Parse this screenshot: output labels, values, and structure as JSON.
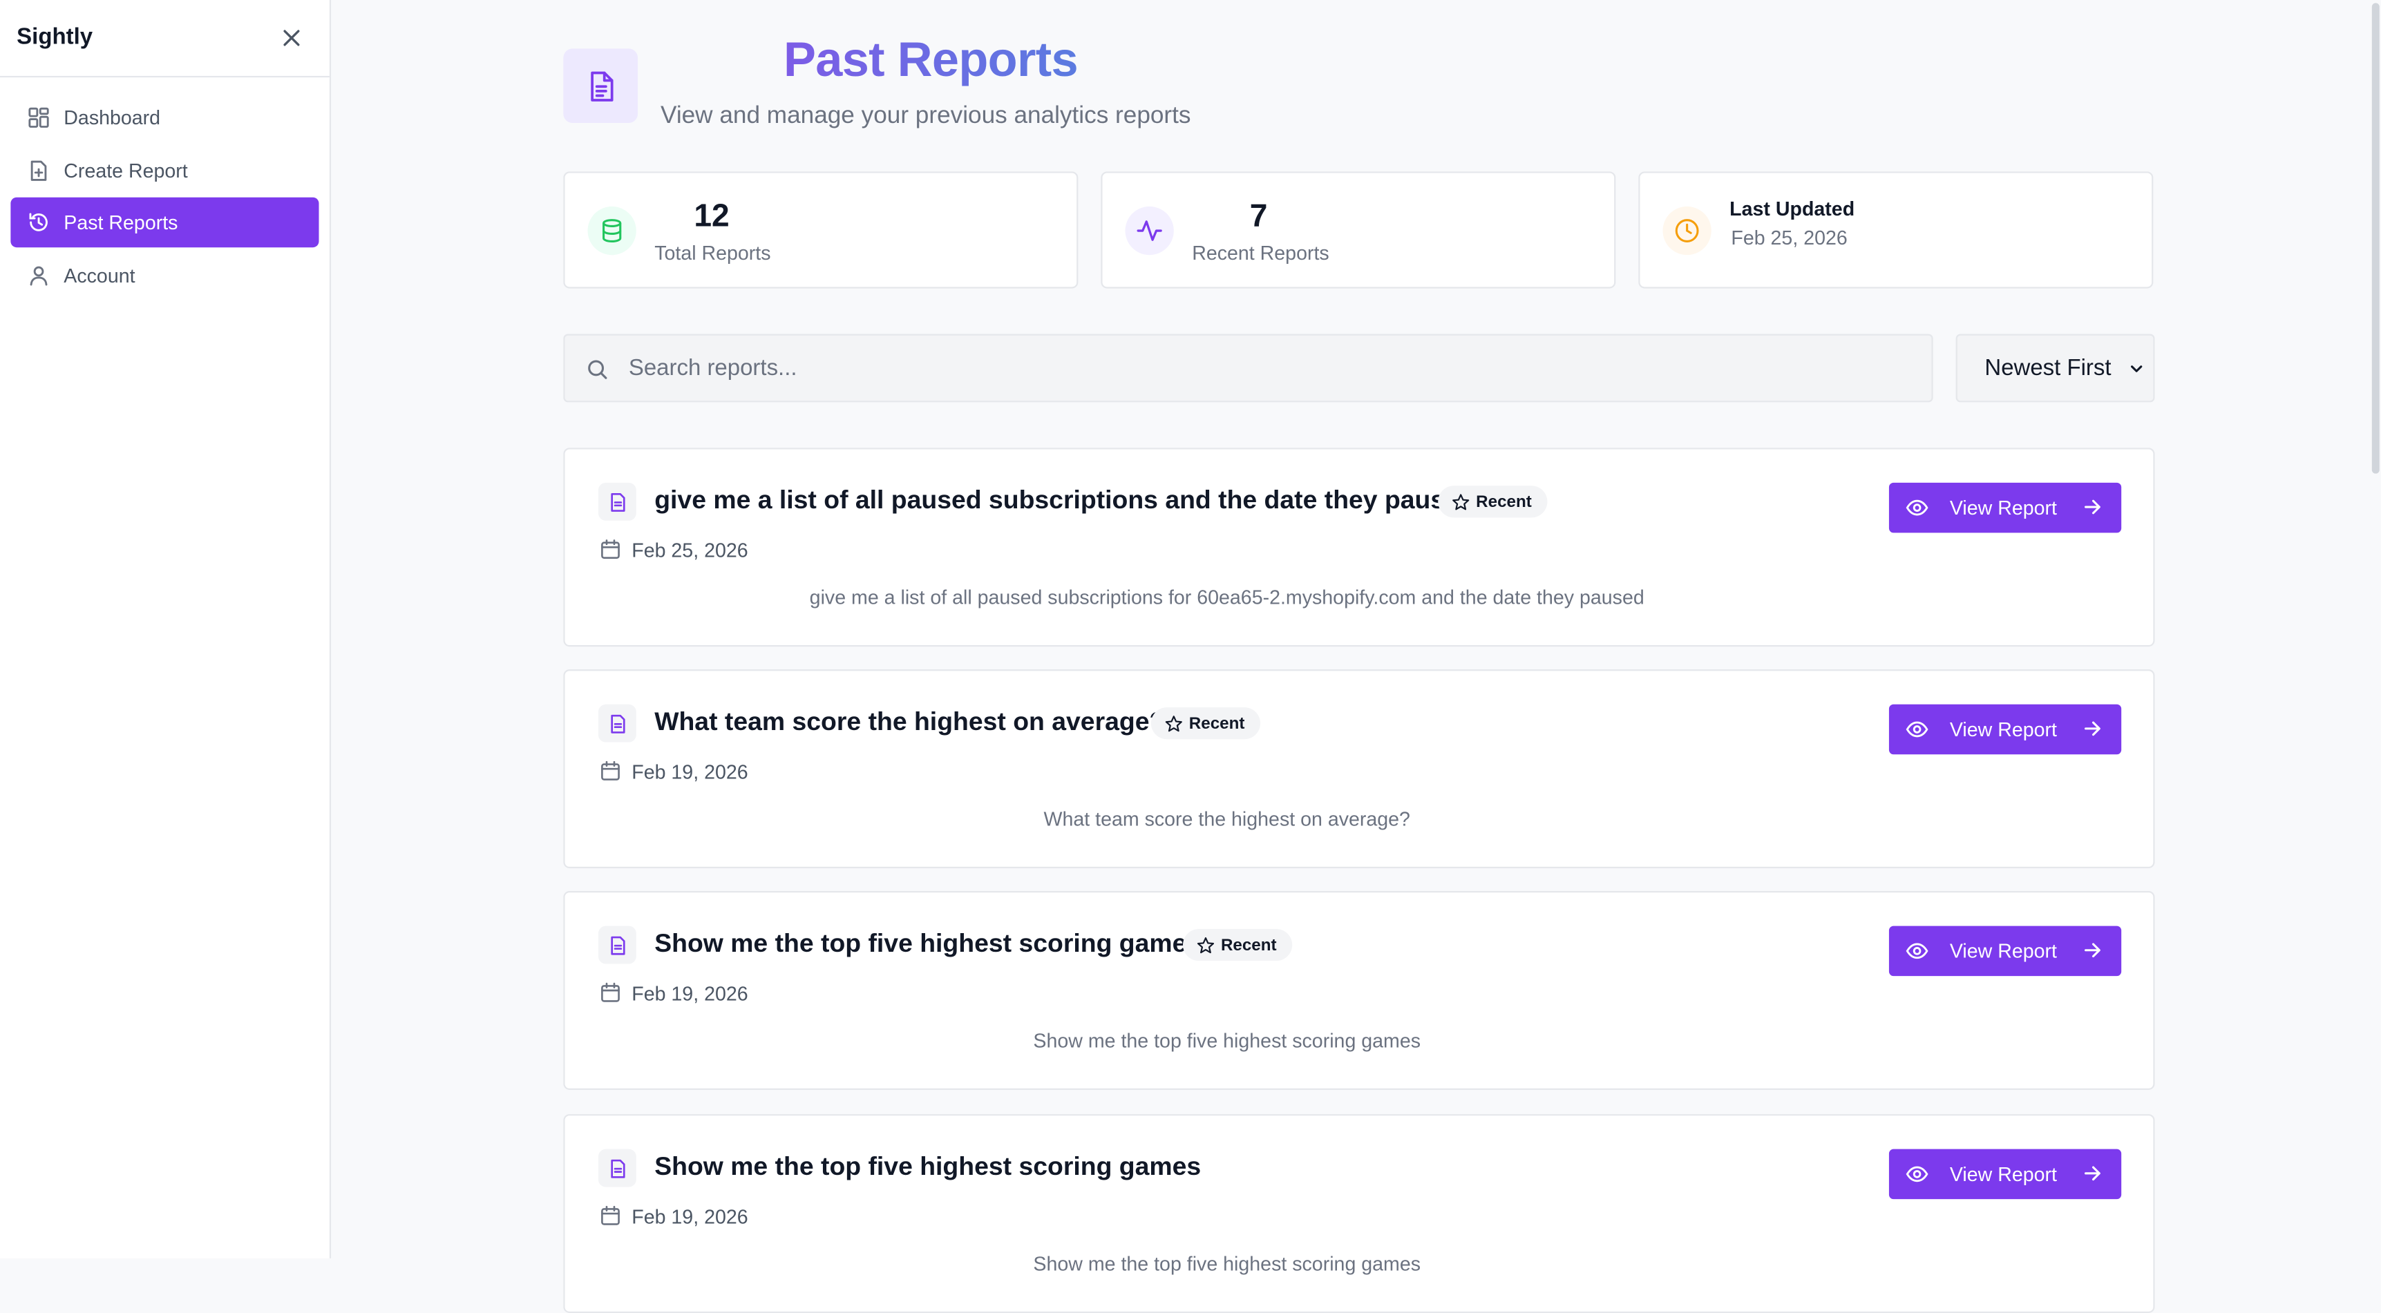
{
  "sidebar": {
    "brand": "Sightly",
    "items": [
      {
        "label": "Dashboard",
        "icon": "dashboard-icon",
        "active": false
      },
      {
        "label": "Create Report",
        "icon": "file-plus-icon",
        "active": false
      },
      {
        "label": "Past Reports",
        "icon": "history-icon",
        "active": true
      },
      {
        "label": "Account",
        "icon": "user-icon",
        "active": false
      }
    ]
  },
  "header": {
    "title": "Past Reports",
    "subtitle": "View and manage your previous analytics reports"
  },
  "stats": {
    "total": {
      "value": "12",
      "label": "Total Reports"
    },
    "recent": {
      "value": "7",
      "label": "Recent Reports"
    },
    "updated": {
      "label": "Last Updated",
      "value": "Feb 25, 2026"
    }
  },
  "search": {
    "placeholder": "Search reports..."
  },
  "sort": {
    "selected": "Newest First"
  },
  "reports": [
    {
      "title": "give me a list of all paused subscriptions and the date they paused",
      "badge": "Recent",
      "date": "Feb 25, 2026",
      "description": "give me a list of all paused subscriptions for 60ea65-2.myshopify.com and the date they paused",
      "button": "View Report"
    },
    {
      "title": "What team score the highest on average?",
      "badge": "Recent",
      "date": "Feb 19, 2026",
      "description": "What team score the highest on average?",
      "button": "View Report"
    },
    {
      "title": "Show me the top five highest scoring games",
      "badge": "Recent",
      "date": "Feb 19, 2026",
      "description": "Show me the top five highest scoring games",
      "button": "View Report"
    },
    {
      "title": "Show me the top five highest scoring games",
      "badge": "",
      "date": "Feb 19, 2026",
      "description": "Show me the top five highest scoring games",
      "button": "View Report"
    }
  ],
  "colors": {
    "accent": "#7c3aed",
    "title_gradient_start": "#7c5ce6",
    "title_gradient_end": "#5b7be0",
    "stat_green": "#22c55e",
    "stat_purple": "#7c3aed",
    "stat_orange": "#f59e0b"
  }
}
